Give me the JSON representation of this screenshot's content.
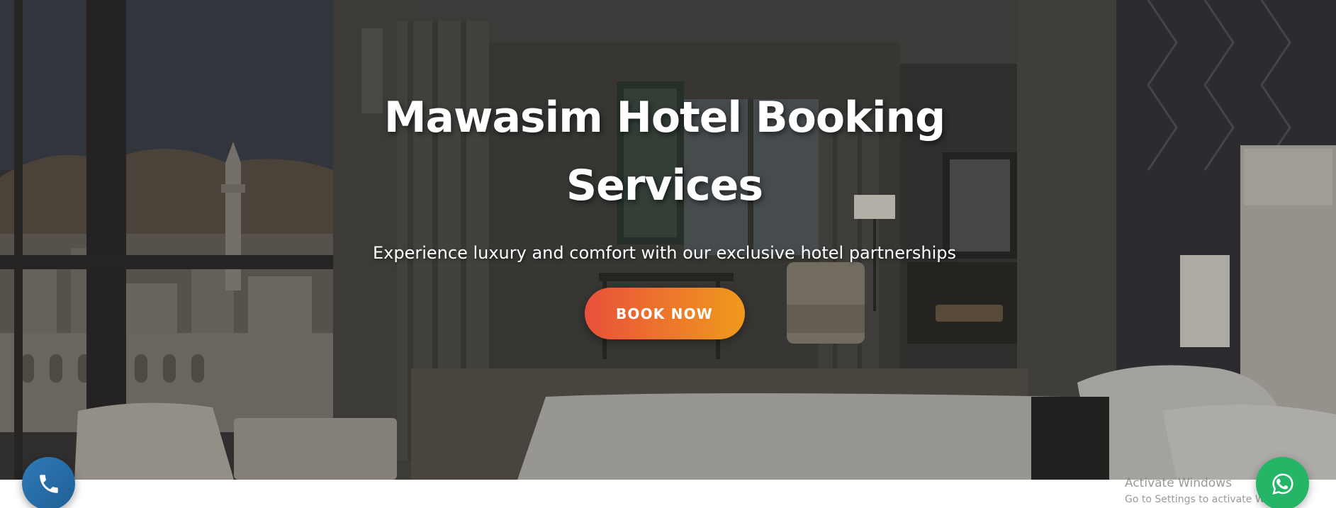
{
  "hero": {
    "title": "Mawasim Hotel Booking Services",
    "subtitle": "Experience luxury and comfort with our exclusive hotel partnerships",
    "cta_label": "BOOK NOW",
    "background_image": "hotel-room-with-city-view"
  },
  "floating": {
    "call_icon": "phone-icon",
    "whatsapp_icon": "whatsapp-icon"
  },
  "watermark": {
    "title": "Activate Windows",
    "subtitle": "Go to Settings to activate Windows."
  },
  "colors": {
    "cta_gradient_start": "#e9503b",
    "cta_gradient_end": "#f09a1c",
    "call_button": "#2a6fa8",
    "whatsapp_button": "#25b567",
    "hero_text": "#ffffff"
  }
}
